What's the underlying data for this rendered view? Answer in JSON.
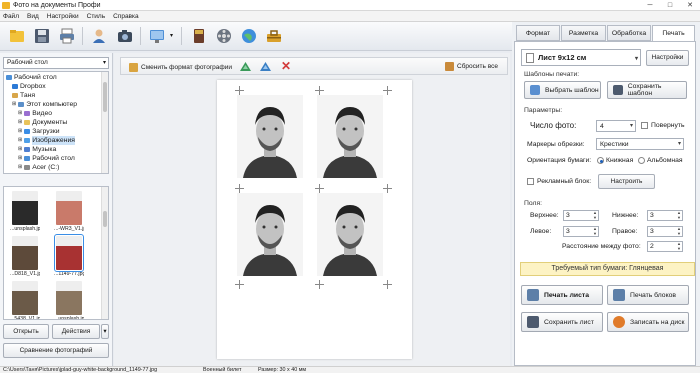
{
  "window": {
    "title": "Фото на документы Профи",
    "minimize": "─",
    "maximize": "□",
    "close": "✕"
  },
  "menu": [
    "Файл",
    "Вид",
    "Настройки",
    "Стиль",
    "Справка"
  ],
  "left": {
    "folder_select": "Рабочий стол",
    "tree": [
      {
        "label": "Рабочий стол",
        "indent": 0,
        "color": "#4a8fd8"
      },
      {
        "label": "Dropbox",
        "indent": 1,
        "color": "#2c7ad6"
      },
      {
        "label": "Таня",
        "indent": 1,
        "color": "#d8a64a"
      },
      {
        "label": "Этот компьютер",
        "indent": 1,
        "color": "#5b8fc9"
      },
      {
        "label": "Видео",
        "indent": 2,
        "color": "#9a6fd1"
      },
      {
        "label": "Документы",
        "indent": 2,
        "color": "#e8c35a"
      },
      {
        "label": "Загрузки",
        "indent": 2,
        "color": "#3a8ee6"
      },
      {
        "label": "Изображения",
        "indent": 2,
        "color": "#4fa0e8",
        "selected": true
      },
      {
        "label": "Музыка",
        "indent": 2,
        "color": "#4f7fd0"
      },
      {
        "label": "Рабочий стол",
        "indent": 2,
        "color": "#4a8fd8"
      },
      {
        "label": "Acer (C:)",
        "indent": 2,
        "color": "#8a8a8a"
      }
    ],
    "thumbnails": [
      {
        "caption": "...unsplash.jpg",
        "color": "#2a2a2a"
      },
      {
        "caption": "...-WR3_V1.jpg",
        "color": "#c97a6a"
      },
      {
        "caption": "...D818_V1.jpg",
        "color": "#5d4a3a"
      },
      {
        "caption": "...1149-77.jpg",
        "color": "#a83232",
        "selected": true
      },
      {
        "caption": "...5438_V1.jpg",
        "color": "#6b5a48"
      },
      {
        "caption": "...unsplash.jpg",
        "color": "#8a7660"
      }
    ],
    "open_button": "Открыть",
    "actions_button": "Действия",
    "compare_button": "Сравнение фотографий"
  },
  "center_toolbar": {
    "change_format": "Сменить формат фотографии",
    "reset_all": "Сбросить все"
  },
  "tabs": [
    "Формат",
    "Разметка",
    "Обработка",
    "Печать"
  ],
  "print": {
    "sheet_size": "Лист 9x12 см",
    "settings_button": "Настройки",
    "templates_title": "Шаблоны печати:",
    "choose_template": "Выбрать шаблон",
    "save_template": "Сохранить шаблон",
    "params_title": "Параметры:",
    "photo_count_label": "Число фото:",
    "photo_count_value": "4",
    "rotate_label": "Повернуть",
    "cut_markers_label": "Маркеры обрезки:",
    "cut_markers_value": "Крестики",
    "orientation_label": "Ориентация бумаги:",
    "orientation_portrait": "Книжная",
    "orientation_landscape": "Альбомная",
    "ad_block_label": "Рекламный блок:",
    "ad_block_button": "Настроить",
    "margins_title": "Поля:",
    "top_label": "Верхнее:",
    "top_value": "3",
    "bottom_label": "Нижнее:",
    "bottom_value": "3",
    "left_label": "Левое:",
    "left_value": "3",
    "right_label": "Правое:",
    "right_value": "3",
    "spacing_label": "Расстояние между фото:",
    "spacing_value": "2",
    "paper_type": "Требуемый тип бумаги: Глянцевая",
    "print_sheet": "Печать листа",
    "print_blocks": "Печать блоков",
    "save_sheet": "Сохранить лист",
    "write_disk": "Записать на диск"
  },
  "status": {
    "path": "C:\\Users\\Таня\\Pictures\\jplad-guy-white-background_1149-77.jpg",
    "doc_type": "Военный билет",
    "size": "Размер: 30 х 40 мм"
  }
}
